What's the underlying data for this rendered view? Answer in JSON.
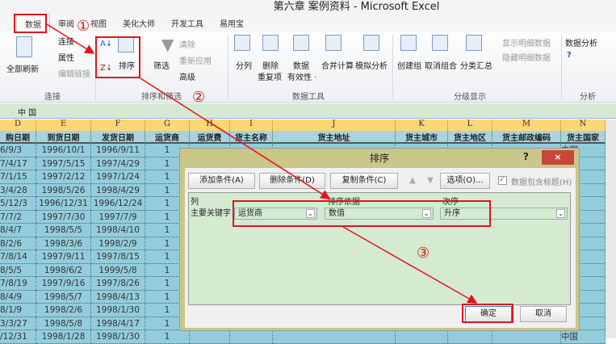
{
  "window": {
    "title": "第六章 案例资料 - Microsoft Excel"
  },
  "tabs": [
    "数据",
    "审阅",
    "视图",
    "美化大师",
    "开发工具",
    "易用宝"
  ],
  "ribbon": {
    "connections": {
      "refresh_all": "全部刷新",
      "connections": "连接",
      "properties": "属性",
      "edit_links": "编辑链接",
      "label": "连接"
    },
    "sort_filter": {
      "sort": "排序",
      "filter": "筛选",
      "clear": "清除",
      "reapply": "重新应用",
      "advanced": "高级",
      "label": "排序和筛选"
    },
    "data_tools": {
      "text_to_columns": "分列",
      "remove_dup_1": "删除",
      "remove_dup_2": "重复项",
      "validation_1": "数据",
      "validation_2": "有效性 ·",
      "consolidate": "合并计算",
      "what_if": "模拟分析",
      "label": "数据工具"
    },
    "outline": {
      "group": "创建组",
      "ungroup": "取消组合",
      "subtotal": "分类汇总",
      "show_detail": "显示明细数据",
      "hide_detail": "隐藏明细数据",
      "label": "分级显示"
    },
    "analysis": {
      "data_analysis": "数据分析",
      "label": "分析"
    }
  },
  "formula_bar": {
    "value": "中 国"
  },
  "columns": [
    "D",
    "E",
    "F",
    "G",
    "H",
    "I",
    "J",
    "K",
    "L",
    "M",
    "N"
  ],
  "field_headers": [
    "购日期",
    "到货日期",
    "发货日期",
    "运货商",
    "运货费",
    "货主名称",
    "货主地址",
    "货主城市",
    "货主地区",
    "货主邮政编码",
    "货主国家"
  ],
  "rows": [
    [
      "6/9/3",
      "1996/10/1",
      "1996/9/11",
      "1"
    ],
    [
      "7/4/17",
      "1997/5/15",
      "1997/4/29",
      "1"
    ],
    [
      "7/1/15",
      "1997/2/12",
      "1997/1/24",
      "1"
    ],
    [
      "3/4/28",
      "1998/5/26",
      "1998/4/29",
      "1"
    ],
    [
      "5/12/3",
      "1996/12/31",
      "1996/12/24",
      "1"
    ],
    [
      "7/7/2",
      "1997/7/30",
      "1997/7/9",
      "1"
    ],
    [
      "8/4/7",
      "1998/5/5",
      "1998/4/10",
      "1"
    ],
    [
      "8/2/6",
      "1998/3/6",
      "1998/2/9",
      "1"
    ],
    [
      "7/8/14",
      "1997/9/11",
      "1997/8/15",
      "1"
    ],
    [
      "8/5/5",
      "1998/6/2",
      "1999/5/8",
      "1"
    ],
    [
      "7/8/19",
      "1997/9/16",
      "1997/8/26",
      "1"
    ],
    [
      "8/4/9",
      "1998/5/7",
      "1998/4/13",
      "1"
    ],
    [
      "8/1/9",
      "1998/2/6",
      "1998/1/30",
      "1"
    ],
    [
      "3/3/27",
      "1998/5/8",
      "1998/4/17",
      "1"
    ],
    [
      "/12/31",
      "1998/1/28",
      "1998/1/30",
      "1"
    ]
  ],
  "country_value": "中国",
  "dialog": {
    "title": "排序",
    "help": "?",
    "close": "×",
    "add_level": "添加条件(A)",
    "delete_level": "删除条件(D)",
    "copy_level": "复制条件(C)",
    "up": "▲",
    "down": "▼",
    "options": "选项(O)...",
    "has_headers": "数据包含标题(H)",
    "has_headers_checked": true,
    "col_header": "列",
    "sort_on_header": "排序依据",
    "order_header": "次序",
    "row_label": "主要关键字",
    "column_value": "运货商",
    "sort_on_value": "数值",
    "order_value": "升序",
    "ok": "确定",
    "cancel": "取消"
  },
  "annotations": {
    "step1": "①",
    "step2": "②",
    "step3": "③",
    "color": "#e0141e"
  }
}
